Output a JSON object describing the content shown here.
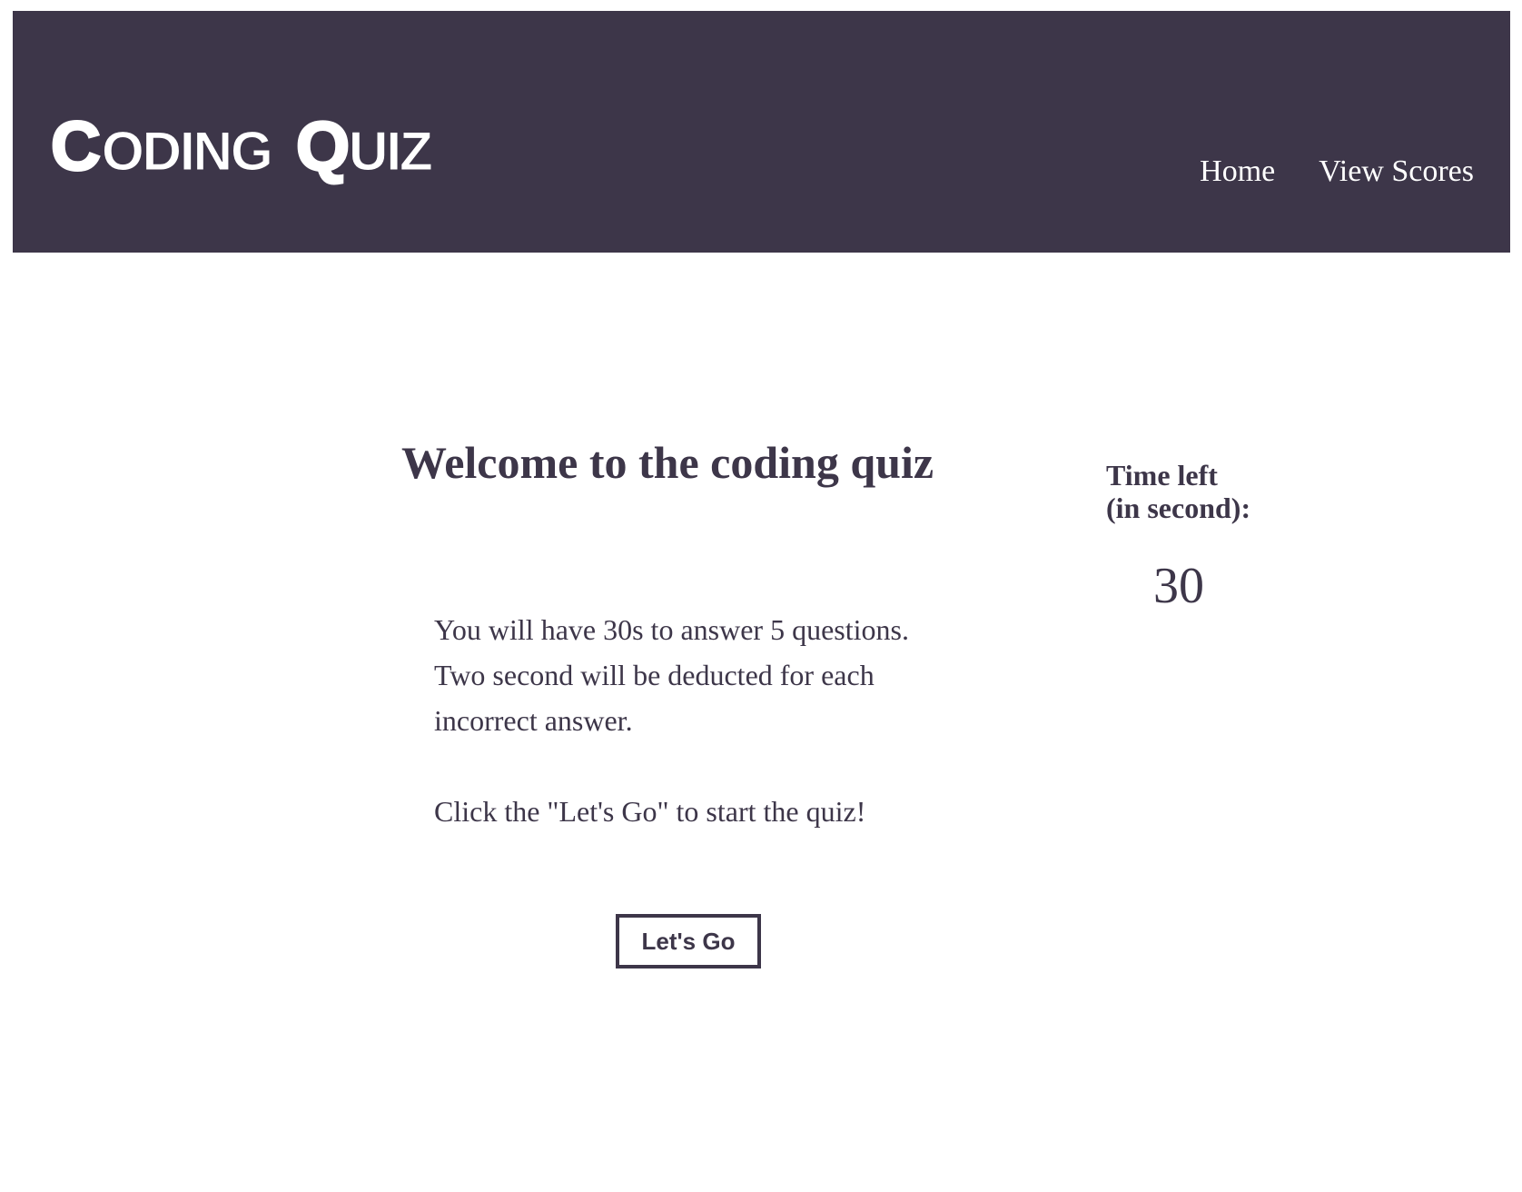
{
  "header": {
    "logo_text": "CODING QUIZ",
    "nav": [
      {
        "label": "Home"
      },
      {
        "label": "View Scores"
      }
    ],
    "background_color": "#3d3649"
  },
  "main": {
    "title": "Welcome to the coding quiz",
    "instructions": {
      "line1": "You will have 30s to answer 5 questions. Two second will be deducted for each incorrect answer.",
      "line2": "Click the \"Let's Go\" to start the quiz!"
    },
    "start_button_label": "Let's Go"
  },
  "timer": {
    "label_line1": "Time left",
    "label_line2": "(in second):",
    "value": "30"
  },
  "colors": {
    "primary": "#3d3649",
    "background": "#ffffff",
    "header_text": "#ffffff"
  }
}
